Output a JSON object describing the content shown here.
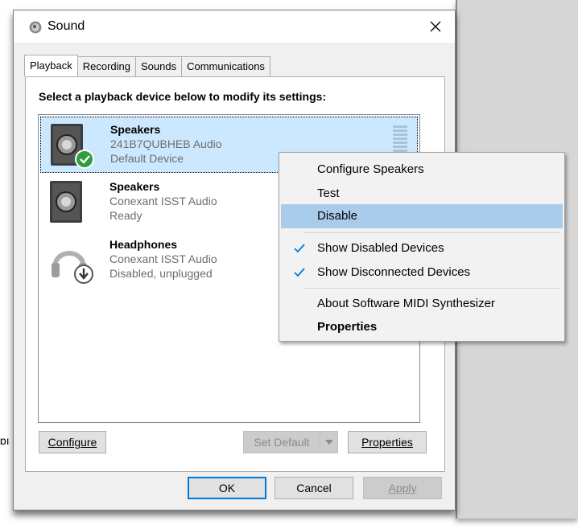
{
  "window": {
    "title": "Sound",
    "close_icon": "close-icon"
  },
  "tabs": [
    {
      "label": "Playback",
      "active": true
    },
    {
      "label": "Recording",
      "active": false
    },
    {
      "label": "Sounds",
      "active": false
    },
    {
      "label": "Communications",
      "active": false
    }
  ],
  "panel": {
    "instruction": "Select a playback device below to modify its settings:",
    "devices": [
      {
        "name": "Speakers",
        "driver": "241B7QUBHEB Audio",
        "status": "Default Device",
        "icon": "speaker-icon",
        "badge": "default-check-icon",
        "selected": true
      },
      {
        "name": "Speakers",
        "driver": "Conexant ISST Audio",
        "status": "Ready",
        "icon": "speaker-icon",
        "selected": false
      },
      {
        "name": "Headphones",
        "driver": "Conexant ISST Audio",
        "status": "Disabled, unplugged",
        "icon": "headphones-icon",
        "badge": "disabled-down-arrow-icon",
        "selected": false
      }
    ],
    "buttons": {
      "configure": "Configure",
      "set_default": "Set Default",
      "properties": "Properties"
    }
  },
  "dialog_buttons": {
    "ok": "OK",
    "cancel": "Cancel",
    "apply": "Apply"
  },
  "context_menu": {
    "items": [
      {
        "label": "Configure Speakers",
        "checked": false
      },
      {
        "label": "Test",
        "checked": false
      },
      {
        "label": "Disable",
        "checked": false,
        "hover": true
      },
      {
        "label": "Show Disabled Devices",
        "checked": true
      },
      {
        "label": "Show Disconnected Devices",
        "checked": true
      },
      {
        "label": "About Software MIDI Synthesizer",
        "checked": false
      },
      {
        "label": "Properties",
        "checked": false,
        "bold": true
      }
    ]
  },
  "colors": {
    "selection": "#cce8ff",
    "menu_hover": "#a9ccea",
    "check": "#0078d7",
    "default_badge": "#2f9e3f"
  }
}
